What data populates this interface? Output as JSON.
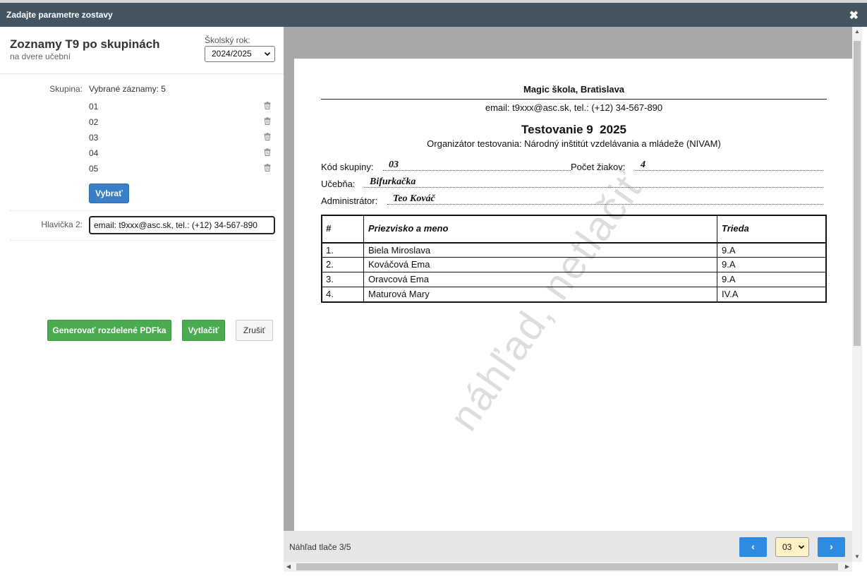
{
  "dialog": {
    "title": "Zadajte parametre zostavy",
    "close_glyph": "✖"
  },
  "left": {
    "report_title": "Zoznamy T9 po skupinách",
    "report_subtitle": "na dvere učební",
    "school_year_label": "Školský rok:",
    "school_year_value": "2024/2025",
    "group_label": "Skupina:",
    "selected_count": "Vybrané záznamy: 5",
    "groups": [
      "01",
      "02",
      "03",
      "04",
      "05"
    ],
    "select_button": "Vybrať",
    "header2_label": "Hlavička 2:",
    "header2_value": "email: t9xxx@asc.sk, tel.: (+12) 34-567-890",
    "generate_button": "Generovať rozdelené PDFka",
    "print_button": "Vytlačiť",
    "cancel_button": "Zrušiť"
  },
  "preview": {
    "school": "Magic škola, Bratislava",
    "contact": "email: t9xxx@asc.sk, tel.: (+12) 34-567-890",
    "heading": "Testovanie 9  2025",
    "organizer": "Organizátor testovania: Národný inštitút vzdelávania a mládeže (NIVAM)",
    "group_code_label": "Kód skupiny:",
    "group_code": "03",
    "student_count_label": "Počet žiakov:",
    "student_count": "4",
    "room_label": "Učebňa:",
    "room": "Bifurkačka",
    "admin_label": "Administrátor:",
    "admin": "Teo Kováč",
    "table_headers": [
      "#",
      "Priezvisko a meno",
      "Trieda"
    ],
    "rows": [
      [
        "1.",
        "Biela Miroslava",
        "9.A"
      ],
      [
        "2.",
        "Kováčová Ema",
        "9.A"
      ],
      [
        "3.",
        "Oravcová Ema",
        "9.A"
      ],
      [
        "4.",
        "Maturová Mary",
        "IV.A"
      ]
    ],
    "watermark": "náhľad, netlačiť"
  },
  "footer": {
    "page_info": "Náhľad tlače 3/5",
    "prev_glyph": "‹",
    "next_glyph": "›",
    "page_value": "03"
  },
  "icons": {
    "trash": "trash-icon",
    "select_arrow": "chevron-down-icon"
  }
}
